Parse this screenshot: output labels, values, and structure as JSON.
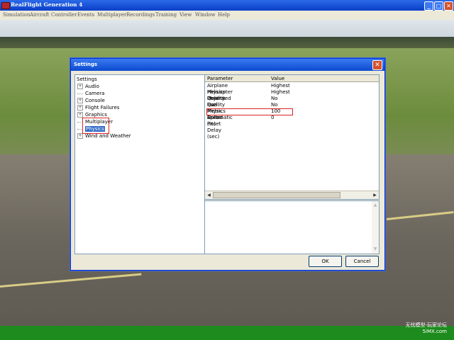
{
  "app": {
    "title": "RealFlight Generation 4"
  },
  "window_controls": {
    "minimize": "_",
    "maximize": "□",
    "close": "✕"
  },
  "menu": [
    "Simulation",
    "Aircraft",
    "Controller",
    "Events",
    "Multiplayer",
    "Recordings",
    "Training",
    "View",
    "Window",
    "Help"
  ],
  "dialog": {
    "title": "Settings",
    "close": "✕",
    "tree_header": "Settings",
    "tree": [
      {
        "label": "Audio",
        "expander": "+"
      },
      {
        "label": "Camera",
        "expander": ""
      },
      {
        "label": "Console",
        "expander": "+"
      },
      {
        "label": "Flight Failures",
        "expander": "+"
      },
      {
        "label": "Graphics",
        "expander": "+"
      },
      {
        "label": "Multiplayer",
        "expander": ""
      },
      {
        "label": "Physics",
        "expander": "",
        "selected": true
      },
      {
        "label": "Wind and Weather",
        "expander": "+"
      }
    ],
    "grid": {
      "headers": [
        "Parameter",
        "Value"
      ],
      "rows": [
        {
          "param": "Airplane Physics Quality",
          "value": "Highest"
        },
        {
          "param": "Helicopter Physics Quality",
          "value": "Highest"
        },
        {
          "param": "Unlimited Fuel",
          "value": "No"
        },
        {
          "param": "Use Metric Units",
          "value": "No"
        },
        {
          "param": "Physics Speed (%)",
          "value": "100"
        },
        {
          "param": "Automatic Reset Delay (sec)",
          "value": "0"
        }
      ]
    },
    "buttons": {
      "ok": "OK",
      "cancel": "Cancel"
    }
  },
  "watermark": {
    "line1": "无忧模型-玩家论坛",
    "line2": "5iMX.com"
  }
}
